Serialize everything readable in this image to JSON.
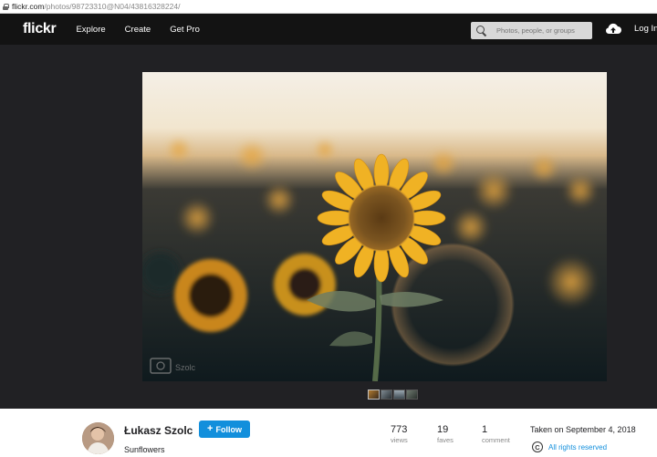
{
  "browser": {
    "url_host": "flickr.com",
    "url_path": "/photos/98723310@N04/43816328224/"
  },
  "nav": {
    "logo": "flickr",
    "links": [
      "Explore",
      "Create",
      "Get Pro"
    ],
    "search_placeholder": "Photos, people, or groups",
    "login": "Log In"
  },
  "photo": {
    "subject": "sunflower field at sunset",
    "watermark": "Szolc",
    "thumbnail_count": 4,
    "selected_thumbnail": 0
  },
  "info": {
    "author": "Łukasz Szolc",
    "follow_label": "Follow",
    "title": "Sunflowers",
    "stats": [
      {
        "value": "773",
        "label": "views"
      },
      {
        "value": "19",
        "label": "faves"
      },
      {
        "value": "1",
        "label": "comment"
      }
    ],
    "taken": "Taken on September 4, 2018",
    "rights_icon": "C",
    "rights": "All rights reserved"
  },
  "colors": {
    "accent": "#128fdc",
    "nav_bg": "#131313",
    "stage_bg": "#212124"
  }
}
